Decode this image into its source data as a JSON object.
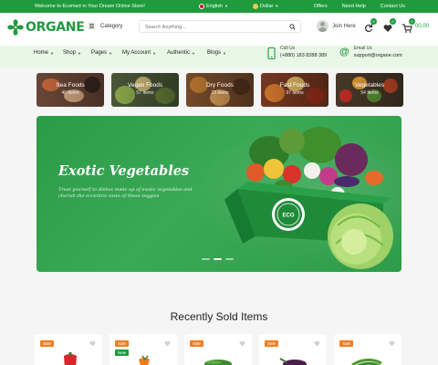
{
  "topbar": {
    "welcome": "Welcome to Ecomart in Your Dream Online Store!",
    "language": "English",
    "currency": "Dollar",
    "links": [
      "Offers",
      "Need Help",
      "Contact Us"
    ]
  },
  "header": {
    "logo": "ORGANE",
    "category_label": "Category",
    "search_placeholder": "Search Anything...",
    "login_label": "Join Here",
    "compare_count": "0",
    "wishlist_count": "0",
    "cart_count": "0",
    "cart_total": "00.00"
  },
  "nav": {
    "items": [
      "Home",
      "Shop",
      "Pages",
      "My Account",
      "Authentic",
      "Blogs"
    ],
    "call_label": "Call Us",
    "call_value": "(+880) 183 8288 389",
    "email_label": "Email Us",
    "email_value": "support@organe.com"
  },
  "categories": [
    {
      "name": "Sea Foods",
      "count": "40 Items"
    },
    {
      "name": "Vegan Foods",
      "count": "57 Items"
    },
    {
      "name": "Dry Foods",
      "count": "23 Items"
    },
    {
      "name": "Fast Foods",
      "count": "97 Items"
    },
    {
      "name": "Vegetables",
      "count": "54 Items"
    }
  ],
  "hero": {
    "title": "Exotic Vegetables",
    "subtitle": "Treat yourself to dishes made up of exotic vegetables and cherish the eccentric taste of these veggies",
    "badge_text": "ECO",
    "slides": 3,
    "active_slide": 1
  },
  "recent": {
    "title": "Recently Sold Items",
    "products": [
      {
        "tags": [
          "Sale"
        ]
      },
      {
        "tags": [
          "Sale",
          "New"
        ]
      },
      {
        "tags": [
          "Sale"
        ]
      },
      {
        "tags": [
          "Sale"
        ]
      },
      {
        "tags": [
          "Sale"
        ]
      }
    ]
  },
  "colors": {
    "brand": "#1f9a3d",
    "nav_bg": "#e9f7e6",
    "sale_tag": "#ef7d22"
  }
}
